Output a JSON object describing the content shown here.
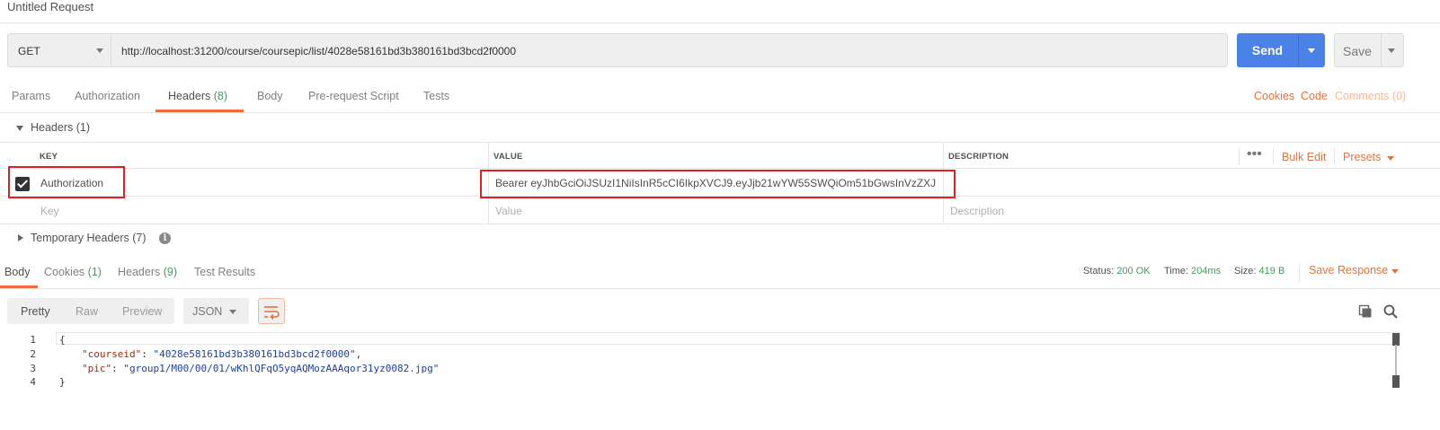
{
  "window": {
    "title": "Untitled Request"
  },
  "request": {
    "method": "GET",
    "url": "http://localhost:31200/course/coursepic/list/4028e58161bd3b380161bd3bcd2f0000",
    "send_label": "Send",
    "save_label": "Save"
  },
  "request_tabs": [
    {
      "label": "Params"
    },
    {
      "label": "Authorization"
    },
    {
      "label": "Headers",
      "count": "(8)",
      "active": true
    },
    {
      "label": "Body"
    },
    {
      "label": "Pre-request Script"
    },
    {
      "label": "Tests"
    }
  ],
  "request_links": {
    "cookies": "Cookies",
    "code": "Code",
    "comments": "Comments (0)"
  },
  "headers_section": {
    "title": "Headers (1)",
    "columns": {
      "key": "KEY",
      "value": "VALUE",
      "description": "DESCRIPTION"
    },
    "actions": {
      "more": "•••",
      "bulk_edit": "Bulk Edit",
      "presets": "Presets"
    },
    "rows": [
      {
        "checked": true,
        "key": "Authorization",
        "value": "Bearer eyJhbGciOiJSUzI1NiIsInR5cCI6IkpXVCJ9.eyJjb21wYW55SWQiOm51bGwsInVzZXJwa...",
        "description": ""
      }
    ],
    "placeholders": {
      "key": "Key",
      "value": "Value",
      "description": "Description"
    }
  },
  "temporary_headers": {
    "title": "Temporary Headers (7)",
    "info_icon": "info-icon"
  },
  "response_tabs": [
    {
      "label": "Body",
      "active": true
    },
    {
      "label": "Cookies",
      "count": "(1)"
    },
    {
      "label": "Headers",
      "count": "(9)"
    },
    {
      "label": "Test Results"
    }
  ],
  "response_status": {
    "status_label": "Status:",
    "status_value": "200 OK",
    "time_label": "Time:",
    "time_value": "204ms",
    "size_label": "Size:",
    "size_value": "419 B",
    "save_response": "Save Response"
  },
  "response_toolbar": {
    "modes": [
      "Pretty",
      "Raw",
      "Preview"
    ],
    "active_mode": "Pretty",
    "format": "JSON",
    "wrap_icon": "wrap-lines-icon",
    "copy_icon": "copy-icon",
    "search_icon": "search-icon"
  },
  "response_body": {
    "line_numbers": [
      "1",
      "2",
      "3",
      "4"
    ],
    "open_brace": "{",
    "close_brace": "}",
    "fields": [
      {
        "key": "\"courseid\"",
        "value": "\"4028e58161bd3b380161bd3bcd2f0000\"",
        "trail": ","
      },
      {
        "key": "\"pic\"",
        "value": "\"group1/M00/00/01/wKhlQFqO5yqAQMozAAAqor31yz0082.jpg\"",
        "trail": ""
      }
    ]
  },
  "colors": {
    "accent": "#f26b3a",
    "send": "#4b82e8",
    "success": "#3f9d5a",
    "highlight_box": "#e02020"
  }
}
